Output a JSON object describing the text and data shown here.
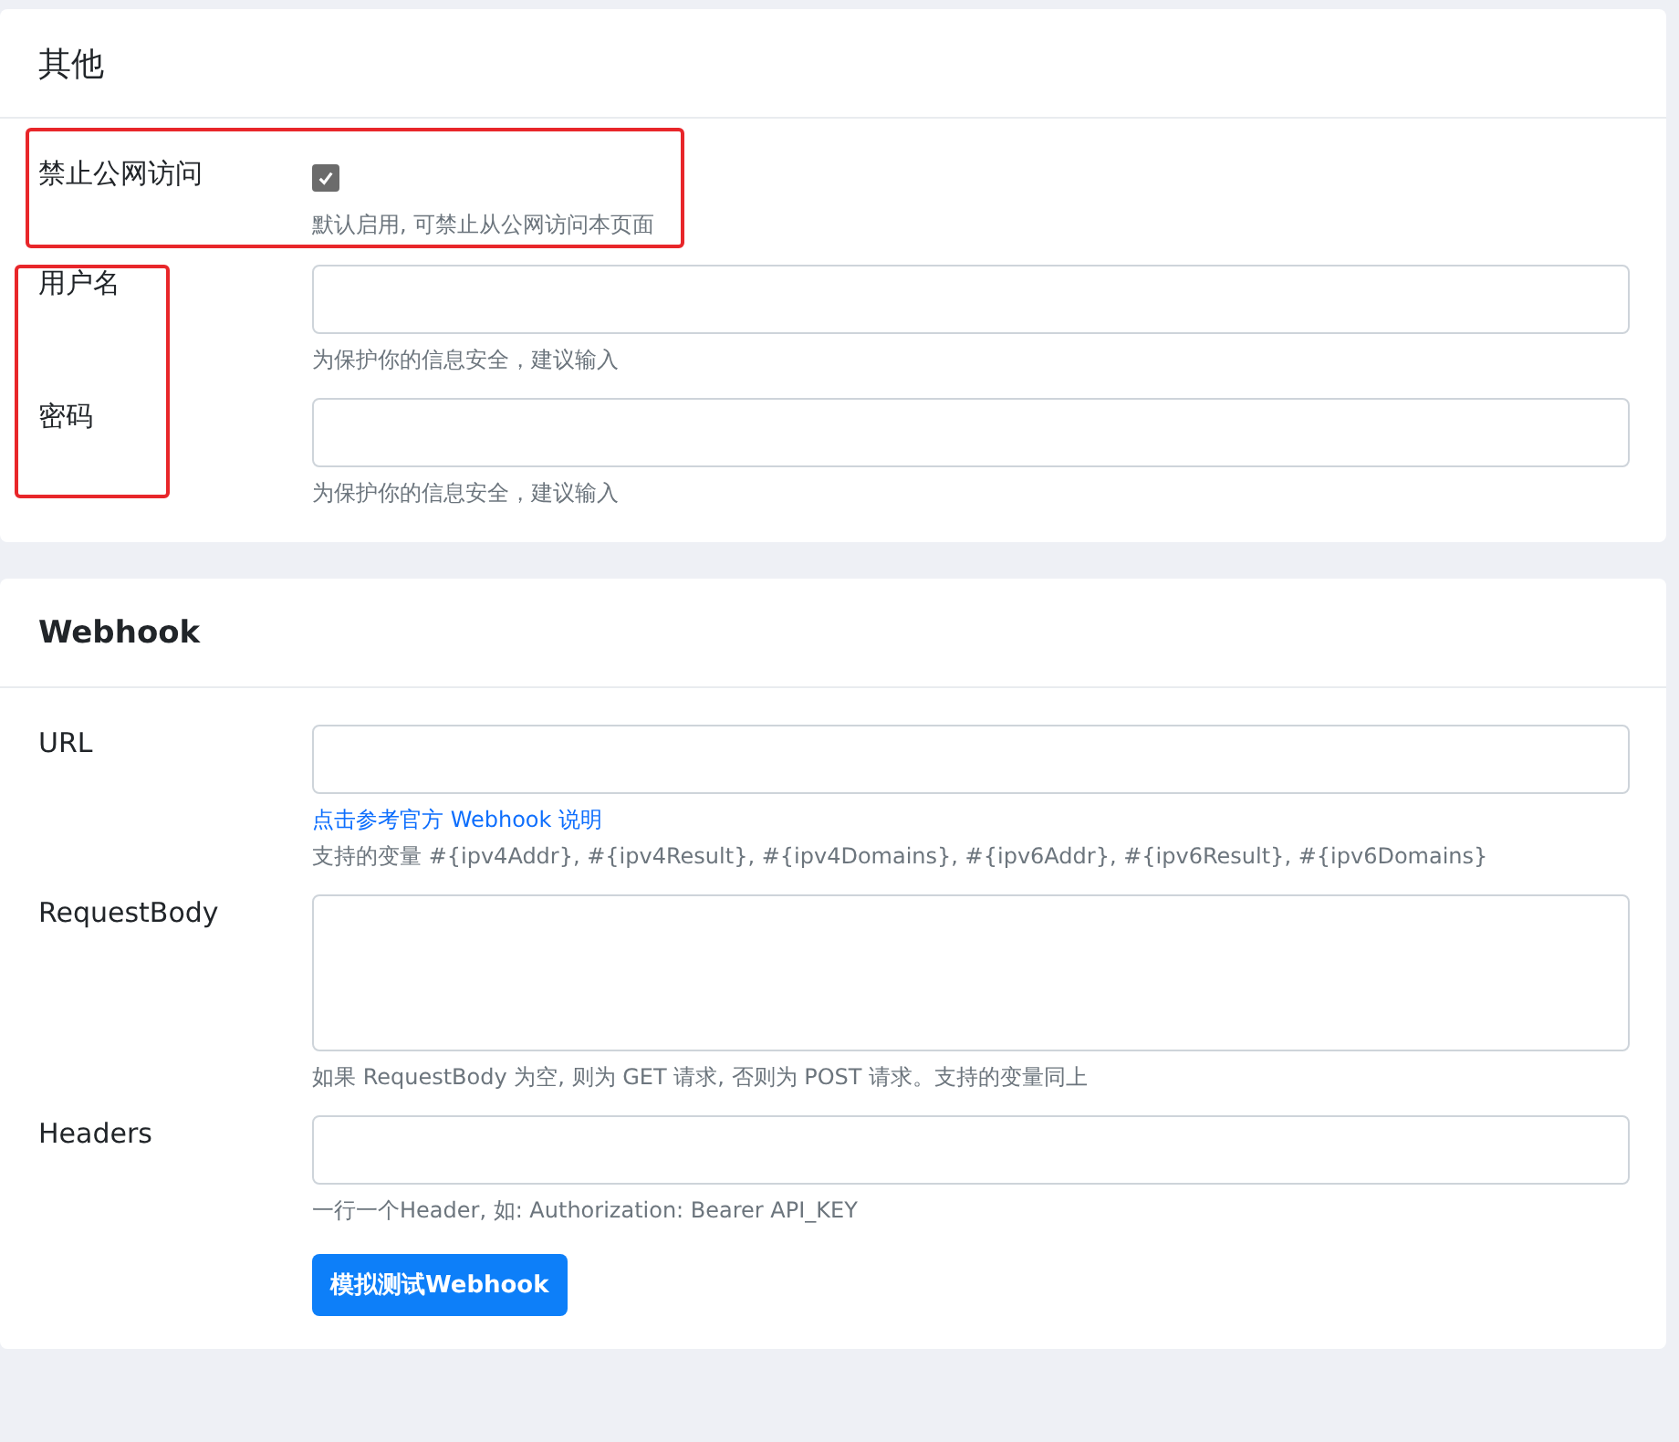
{
  "sections": [
    {
      "title": "其他",
      "groups": [
        {
          "kind": "framedrow",
          "fields": [
            {
              "kind": "checkbox",
              "label": "禁止公网访问",
              "checked": true,
              "notes": [
                {
                  "kind": "text",
                  "text": "默认启用, 可禁止从公网访问本页面"
                }
              ]
            }
          ]
        },
        {
          "kind": "framedlabels",
          "fields": [
            {
              "kind": "input",
              "label": "用户名",
              "notes": [
                {
                  "kind": "text",
                  "text": "为保护你的信息安全，建议输入"
                }
              ]
            },
            {
              "kind": "input",
              "label": "密码",
              "notes": [
                {
                  "kind": "text",
                  "text": "为保护你的信息安全，建议输入"
                }
              ]
            }
          ]
        }
      ]
    },
    {
      "title": "Webhook",
      "groups": [
        {
          "kind": "plain",
          "fields": [
            {
              "kind": "input",
              "label": "URL",
              "notes": [
                {
                  "kind": "link",
                  "text": "点击参考官方 Webhook 说明"
                },
                {
                  "kind": "text",
                  "text": "支持的变量 #{ipv4Addr}, #{ipv4Result}, #{ipv4Domains}, #{ipv6Addr}, #{ipv6Result}, #{ipv6Domains}"
                }
              ]
            },
            {
              "kind": "textarea",
              "label": "RequestBody",
              "notes": [
                {
                  "kind": "text",
                  "text": "如果 RequestBody 为空, 则为 GET 请求, 否则为 POST 请求。支持的变量同上"
                }
              ]
            },
            {
              "kind": "textbox",
              "label": "Headers",
              "notes": [
                {
                  "kind": "text",
                  "text": "一行一个Header, 如: Authorization: Bearer API_KEY"
                }
              ]
            },
            {
              "kind": "button",
              "button": "模拟测试Webhook"
            }
          ]
        }
      ]
    }
  ]
}
